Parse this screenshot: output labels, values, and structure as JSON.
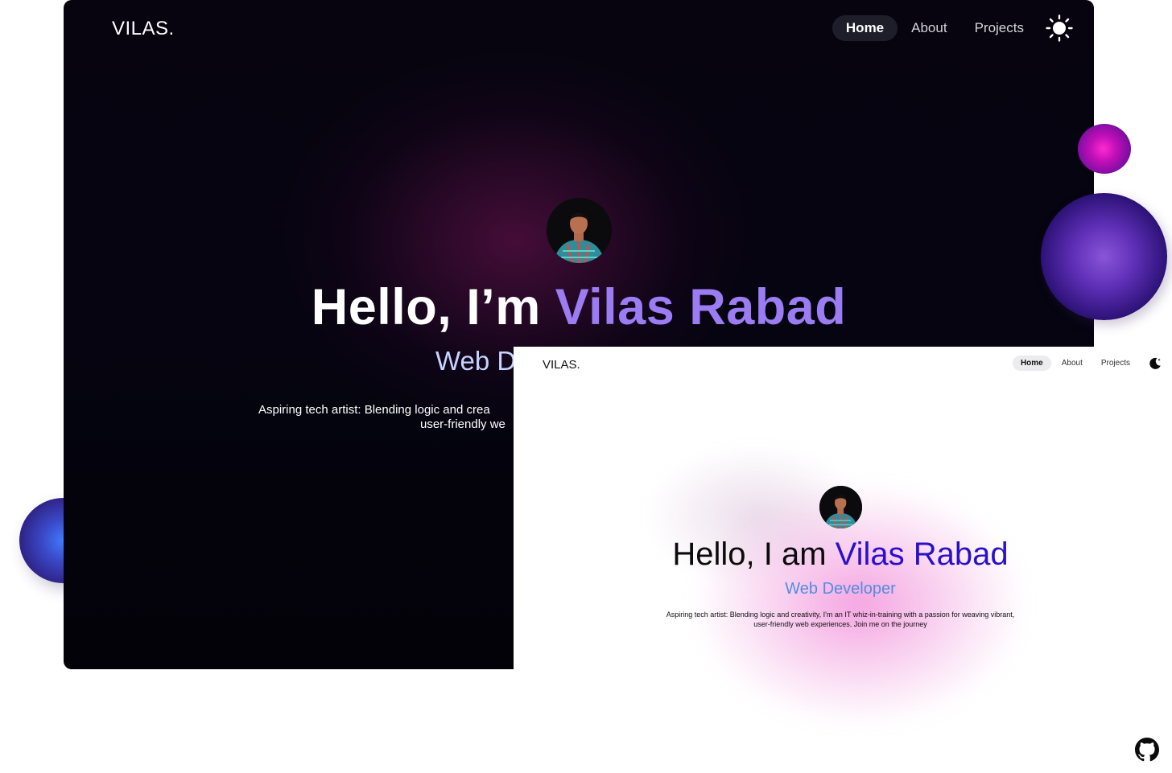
{
  "dark": {
    "logo": "VILAS.",
    "nav": {
      "home": "Home",
      "about": "About",
      "projects": "Projects"
    },
    "theme_icon": "sun-icon",
    "title_prefix": "Hello, I’m ",
    "title_name": "Vilas Rabad",
    "subtitle": "Web D",
    "desc_line1": "Aspiring tech artist: Blending logic and crea",
    "desc_line2": "user-friendly we"
  },
  "light": {
    "logo": "VILAS.",
    "nav": {
      "home": "Home",
      "about": "About",
      "projects": "Projects"
    },
    "theme_icon": "moon-icon",
    "title_prefix": "Hello, I am ",
    "title_name": "Vilas Rabad",
    "subtitle": "Web Developer",
    "desc_line1": "Aspiring tech artist: Blending logic and creativity, I'm an IT whiz-in-training with a passion for weaving vibrant,",
    "desc_line2": "user-friendly web experiences. Join me on the journey"
  },
  "colors": {
    "dark_accent": "#9b7cf2",
    "light_accent": "#2a10c9",
    "light_subtitle": "#4f8fe0"
  },
  "footer_icon": "github-icon"
}
